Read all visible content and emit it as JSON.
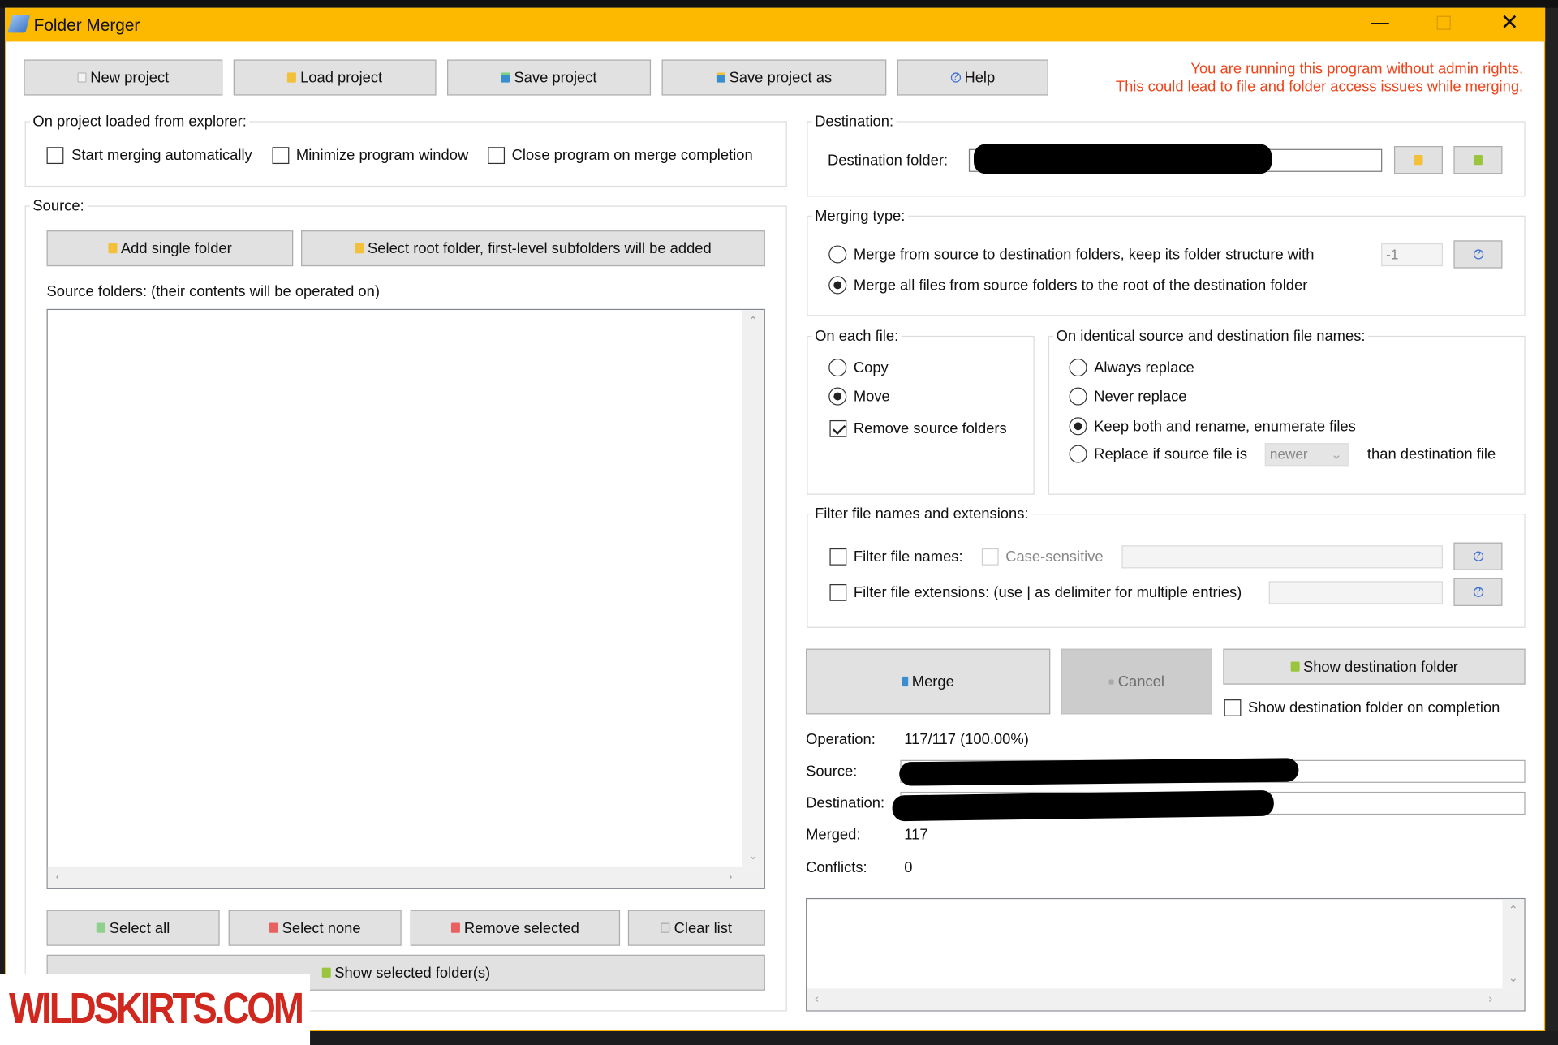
{
  "window": {
    "title": "Folder Merger",
    "accent": "#fdb900"
  },
  "toolbar": {
    "new_project": "New project",
    "load_project": "Load project",
    "save_project": "Save project",
    "save_project_as": "Save project as",
    "help": "Help"
  },
  "warning": {
    "line1": "You are running this program without admin rights.",
    "line2": "This could lead to file and folder access issues while merging.",
    "color": "#f0441a"
  },
  "explorer_group": {
    "title": "On project loaded from explorer:",
    "start_merging": {
      "label": "Start merging automatically",
      "checked": false
    },
    "minimize": {
      "label": "Minimize program window",
      "checked": false
    },
    "close_program": {
      "label": "Close program on merge completion",
      "checked": false
    }
  },
  "source": {
    "title": "Source:",
    "add_single": "Add single folder",
    "select_root": "Select root folder, first-level subfolders will be added",
    "list_label": "Source folders: (their contents will be operated on)",
    "items": [],
    "select_all": "Select all",
    "select_none": "Select none",
    "remove_selected": "Remove selected",
    "clear_list": "Clear list",
    "show_selected": "Show selected folder(s)"
  },
  "destination": {
    "title": "Destination:",
    "folder_label": "Destination folder:"
  },
  "merging_type": {
    "title": "Merging type:",
    "option1": {
      "label": "Merge from source to destination folders, keep its folder structure with",
      "selected": false
    },
    "depth_value": "-1",
    "option2": {
      "label": "Merge all files from source folders to the root of the destination folder",
      "selected": true
    }
  },
  "on_each_file": {
    "title": "On each file:",
    "copy": {
      "label": "Copy",
      "selected": false
    },
    "move": {
      "label": "Move",
      "selected": true
    },
    "remove_source": {
      "label": "Remove source folders",
      "checked": true
    }
  },
  "identical": {
    "title": "On identical source and destination file names:",
    "always_replace": {
      "label": "Always replace",
      "selected": false
    },
    "never_replace": {
      "label": "Never replace",
      "selected": false
    },
    "keep_both": {
      "label": "Keep both and rename, enumerate files",
      "selected": true
    },
    "replace_if": {
      "label": "Replace if source file is",
      "selected": false
    },
    "compare_value": "newer",
    "than_label": "than destination file"
  },
  "filter": {
    "title": "Filter file names and extensions:",
    "names": {
      "label": "Filter file names:",
      "checked": false
    },
    "case_sensitive": {
      "label": "Case-sensitive",
      "checked": false
    },
    "extensions": {
      "label": "Filter file extensions: (use | as delimiter for multiple entries)",
      "checked": false
    }
  },
  "actions": {
    "merge": "Merge",
    "cancel": "Cancel",
    "show_destination": "Show destination folder",
    "show_on_completion": {
      "label": "Show destination folder on completion",
      "checked": false
    }
  },
  "status": {
    "operation_label": "Operation:",
    "operation_value": "117/117 (100.00%)",
    "source_label": "Source:",
    "destination_label": "Destination:",
    "merged_label": "Merged:",
    "merged_value": "117",
    "conflicts_label": "Conflicts:",
    "conflicts_value": "0"
  },
  "watermark": "WILDSKIRTS.COM"
}
